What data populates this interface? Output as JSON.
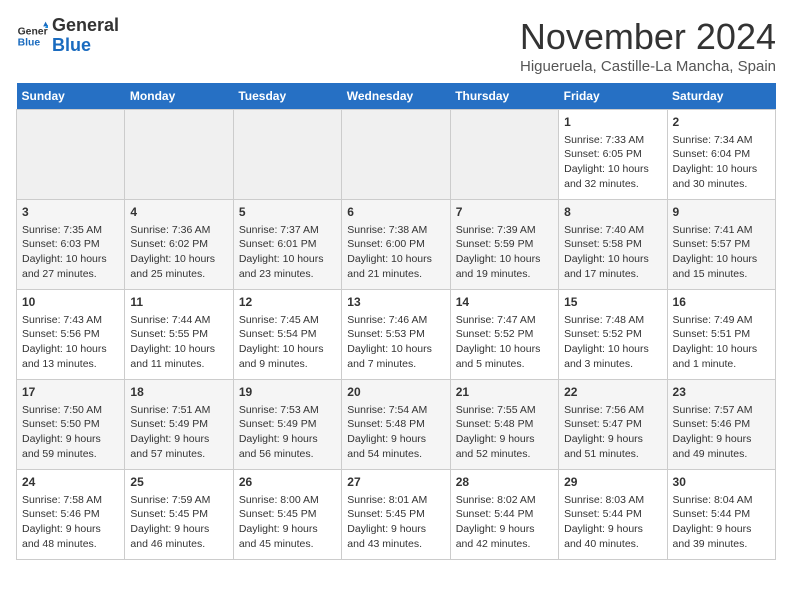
{
  "header": {
    "logo_line1": "General",
    "logo_line2": "Blue",
    "month": "November 2024",
    "location": "Higueruela, Castille-La Mancha, Spain"
  },
  "weekdays": [
    "Sunday",
    "Monday",
    "Tuesday",
    "Wednesday",
    "Thursday",
    "Friday",
    "Saturday"
  ],
  "weeks": [
    [
      {
        "day": "",
        "info": ""
      },
      {
        "day": "",
        "info": ""
      },
      {
        "day": "",
        "info": ""
      },
      {
        "day": "",
        "info": ""
      },
      {
        "day": "",
        "info": ""
      },
      {
        "day": "1",
        "info": "Sunrise: 7:33 AM\nSunset: 6:05 PM\nDaylight: 10 hours and 32 minutes."
      },
      {
        "day": "2",
        "info": "Sunrise: 7:34 AM\nSunset: 6:04 PM\nDaylight: 10 hours and 30 minutes."
      }
    ],
    [
      {
        "day": "3",
        "info": "Sunrise: 7:35 AM\nSunset: 6:03 PM\nDaylight: 10 hours and 27 minutes."
      },
      {
        "day": "4",
        "info": "Sunrise: 7:36 AM\nSunset: 6:02 PM\nDaylight: 10 hours and 25 minutes."
      },
      {
        "day": "5",
        "info": "Sunrise: 7:37 AM\nSunset: 6:01 PM\nDaylight: 10 hours and 23 minutes."
      },
      {
        "day": "6",
        "info": "Sunrise: 7:38 AM\nSunset: 6:00 PM\nDaylight: 10 hours and 21 minutes."
      },
      {
        "day": "7",
        "info": "Sunrise: 7:39 AM\nSunset: 5:59 PM\nDaylight: 10 hours and 19 minutes."
      },
      {
        "day": "8",
        "info": "Sunrise: 7:40 AM\nSunset: 5:58 PM\nDaylight: 10 hours and 17 minutes."
      },
      {
        "day": "9",
        "info": "Sunrise: 7:41 AM\nSunset: 5:57 PM\nDaylight: 10 hours and 15 minutes."
      }
    ],
    [
      {
        "day": "10",
        "info": "Sunrise: 7:43 AM\nSunset: 5:56 PM\nDaylight: 10 hours and 13 minutes."
      },
      {
        "day": "11",
        "info": "Sunrise: 7:44 AM\nSunset: 5:55 PM\nDaylight: 10 hours and 11 minutes."
      },
      {
        "day": "12",
        "info": "Sunrise: 7:45 AM\nSunset: 5:54 PM\nDaylight: 10 hours and 9 minutes."
      },
      {
        "day": "13",
        "info": "Sunrise: 7:46 AM\nSunset: 5:53 PM\nDaylight: 10 hours and 7 minutes."
      },
      {
        "day": "14",
        "info": "Sunrise: 7:47 AM\nSunset: 5:52 PM\nDaylight: 10 hours and 5 minutes."
      },
      {
        "day": "15",
        "info": "Sunrise: 7:48 AM\nSunset: 5:52 PM\nDaylight: 10 hours and 3 minutes."
      },
      {
        "day": "16",
        "info": "Sunrise: 7:49 AM\nSunset: 5:51 PM\nDaylight: 10 hours and 1 minute."
      }
    ],
    [
      {
        "day": "17",
        "info": "Sunrise: 7:50 AM\nSunset: 5:50 PM\nDaylight: 9 hours and 59 minutes."
      },
      {
        "day": "18",
        "info": "Sunrise: 7:51 AM\nSunset: 5:49 PM\nDaylight: 9 hours and 57 minutes."
      },
      {
        "day": "19",
        "info": "Sunrise: 7:53 AM\nSunset: 5:49 PM\nDaylight: 9 hours and 56 minutes."
      },
      {
        "day": "20",
        "info": "Sunrise: 7:54 AM\nSunset: 5:48 PM\nDaylight: 9 hours and 54 minutes."
      },
      {
        "day": "21",
        "info": "Sunrise: 7:55 AM\nSunset: 5:48 PM\nDaylight: 9 hours and 52 minutes."
      },
      {
        "day": "22",
        "info": "Sunrise: 7:56 AM\nSunset: 5:47 PM\nDaylight: 9 hours and 51 minutes."
      },
      {
        "day": "23",
        "info": "Sunrise: 7:57 AM\nSunset: 5:46 PM\nDaylight: 9 hours and 49 minutes."
      }
    ],
    [
      {
        "day": "24",
        "info": "Sunrise: 7:58 AM\nSunset: 5:46 PM\nDaylight: 9 hours and 48 minutes."
      },
      {
        "day": "25",
        "info": "Sunrise: 7:59 AM\nSunset: 5:45 PM\nDaylight: 9 hours and 46 minutes."
      },
      {
        "day": "26",
        "info": "Sunrise: 8:00 AM\nSunset: 5:45 PM\nDaylight: 9 hours and 45 minutes."
      },
      {
        "day": "27",
        "info": "Sunrise: 8:01 AM\nSunset: 5:45 PM\nDaylight: 9 hours and 43 minutes."
      },
      {
        "day": "28",
        "info": "Sunrise: 8:02 AM\nSunset: 5:44 PM\nDaylight: 9 hours and 42 minutes."
      },
      {
        "day": "29",
        "info": "Sunrise: 8:03 AM\nSunset: 5:44 PM\nDaylight: 9 hours and 40 minutes."
      },
      {
        "day": "30",
        "info": "Sunrise: 8:04 AM\nSunset: 5:44 PM\nDaylight: 9 hours and 39 minutes."
      }
    ]
  ]
}
